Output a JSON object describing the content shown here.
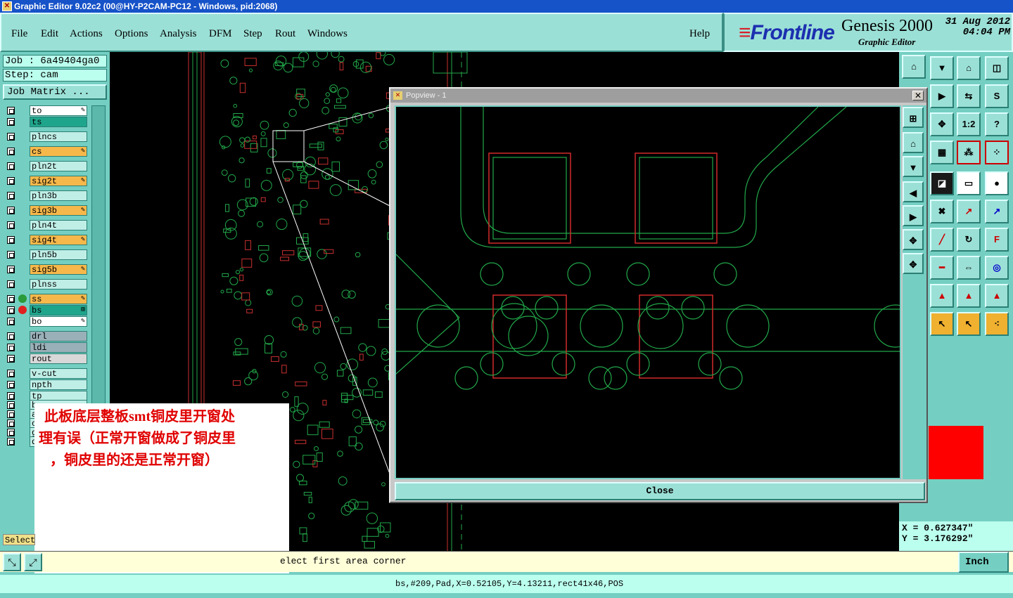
{
  "window": {
    "title": "Graphic Editor 9.02c2 (00@HY-P2CAM-PC12 - Windows, pid:2068)"
  },
  "menu": {
    "items": [
      "File",
      "Edit",
      "Actions",
      "Options",
      "Analysis",
      "DFM",
      "Step",
      "Rout",
      "Windows"
    ],
    "help": "Help"
  },
  "brand": {
    "logo": "Frontline",
    "product": "Genesis 2000",
    "subtitle": "Graphic Editor",
    "date": "31 Aug 2012",
    "time": "04:04 PM"
  },
  "job": {
    "job_label": "Job : 6a49404ga0",
    "step_label": "Step: cam",
    "matrix_button": "Job Matrix ..."
  },
  "layers": [
    {
      "name": "to",
      "color": "#ffffff",
      "marker": "pen"
    },
    {
      "name": "ts",
      "color": "#1fa58c",
      "marker": ""
    },
    {
      "name": "plncs",
      "color": "#bfeee6",
      "marker": ""
    },
    {
      "name": "cs",
      "color": "#f7b84b",
      "marker": "pen"
    },
    {
      "name": "pln2t",
      "color": "#bfeee6",
      "marker": ""
    },
    {
      "name": "sig2t",
      "color": "#f7b84b",
      "marker": "pen"
    },
    {
      "name": "pln3b",
      "color": "#bfeee6",
      "marker": ""
    },
    {
      "name": "sig3b",
      "color": "#f7b84b",
      "marker": "pen"
    },
    {
      "name": "pln4t",
      "color": "#bfeee6",
      "marker": ""
    },
    {
      "name": "sig4t",
      "color": "#f7b84b",
      "marker": "pen"
    },
    {
      "name": "pln5b",
      "color": "#bfeee6",
      "marker": ""
    },
    {
      "name": "sig5b",
      "color": "#f7b84b",
      "marker": "pen"
    },
    {
      "name": "plnss",
      "color": "#bfeee6",
      "marker": ""
    },
    {
      "name": "ss",
      "color": "#f7b84b",
      "marker": "pen"
    },
    {
      "name": "bs",
      "color": "#1fa58c",
      "marker": "grid"
    },
    {
      "name": "bo",
      "color": "#ffffff",
      "marker": "pen"
    },
    {
      "name": "drl",
      "color": "#9ab0b8",
      "marker": ""
    },
    {
      "name": "ldi",
      "color": "#9ab0b8",
      "marker": ""
    },
    {
      "name": "rout",
      "color": "#d8d8d8",
      "marker": ""
    },
    {
      "name": "v-cut",
      "color": "#bfeee6",
      "marker": ""
    },
    {
      "name": "npth",
      "color": "#bfeee6",
      "marker": ""
    },
    {
      "name": "tp",
      "color": "#bfeee6",
      "marker": ""
    },
    {
      "name": "b",
      "color": "#bfeee6",
      "marker": ""
    },
    {
      "name": "a",
      "color": "#bfeee6",
      "marker": ""
    },
    {
      "name": "c",
      "color": "#bfeee6",
      "marker": ""
    },
    {
      "name": "g",
      "color": "#bfeee6",
      "marker": ""
    },
    {
      "name": "d",
      "color": "#bfeee6",
      "marker": ""
    }
  ],
  "popup": {
    "title": "Popview - 1",
    "close_label": "Close",
    "close_x": "✕"
  },
  "annotation": {
    "lines": [
      "此板底层整板smt铜皮里开窗处",
      "理有误（正常开窗做成了铜皮里",
      "，铜皮里的还是正常开窗）"
    ]
  },
  "coords": {
    "x": "X = 0.627347\"",
    "y": "Y = 3.176292\""
  },
  "select_label": "Select",
  "prompt": "elect first area corner",
  "unit": "Inch",
  "status": "bs,#209,Pad,X=0.52105,Y=4.13211,rect41x46,POS",
  "colors": {
    "panel": "#74cfc2",
    "copper": "#22a84a",
    "pad": "#d12a2a"
  }
}
